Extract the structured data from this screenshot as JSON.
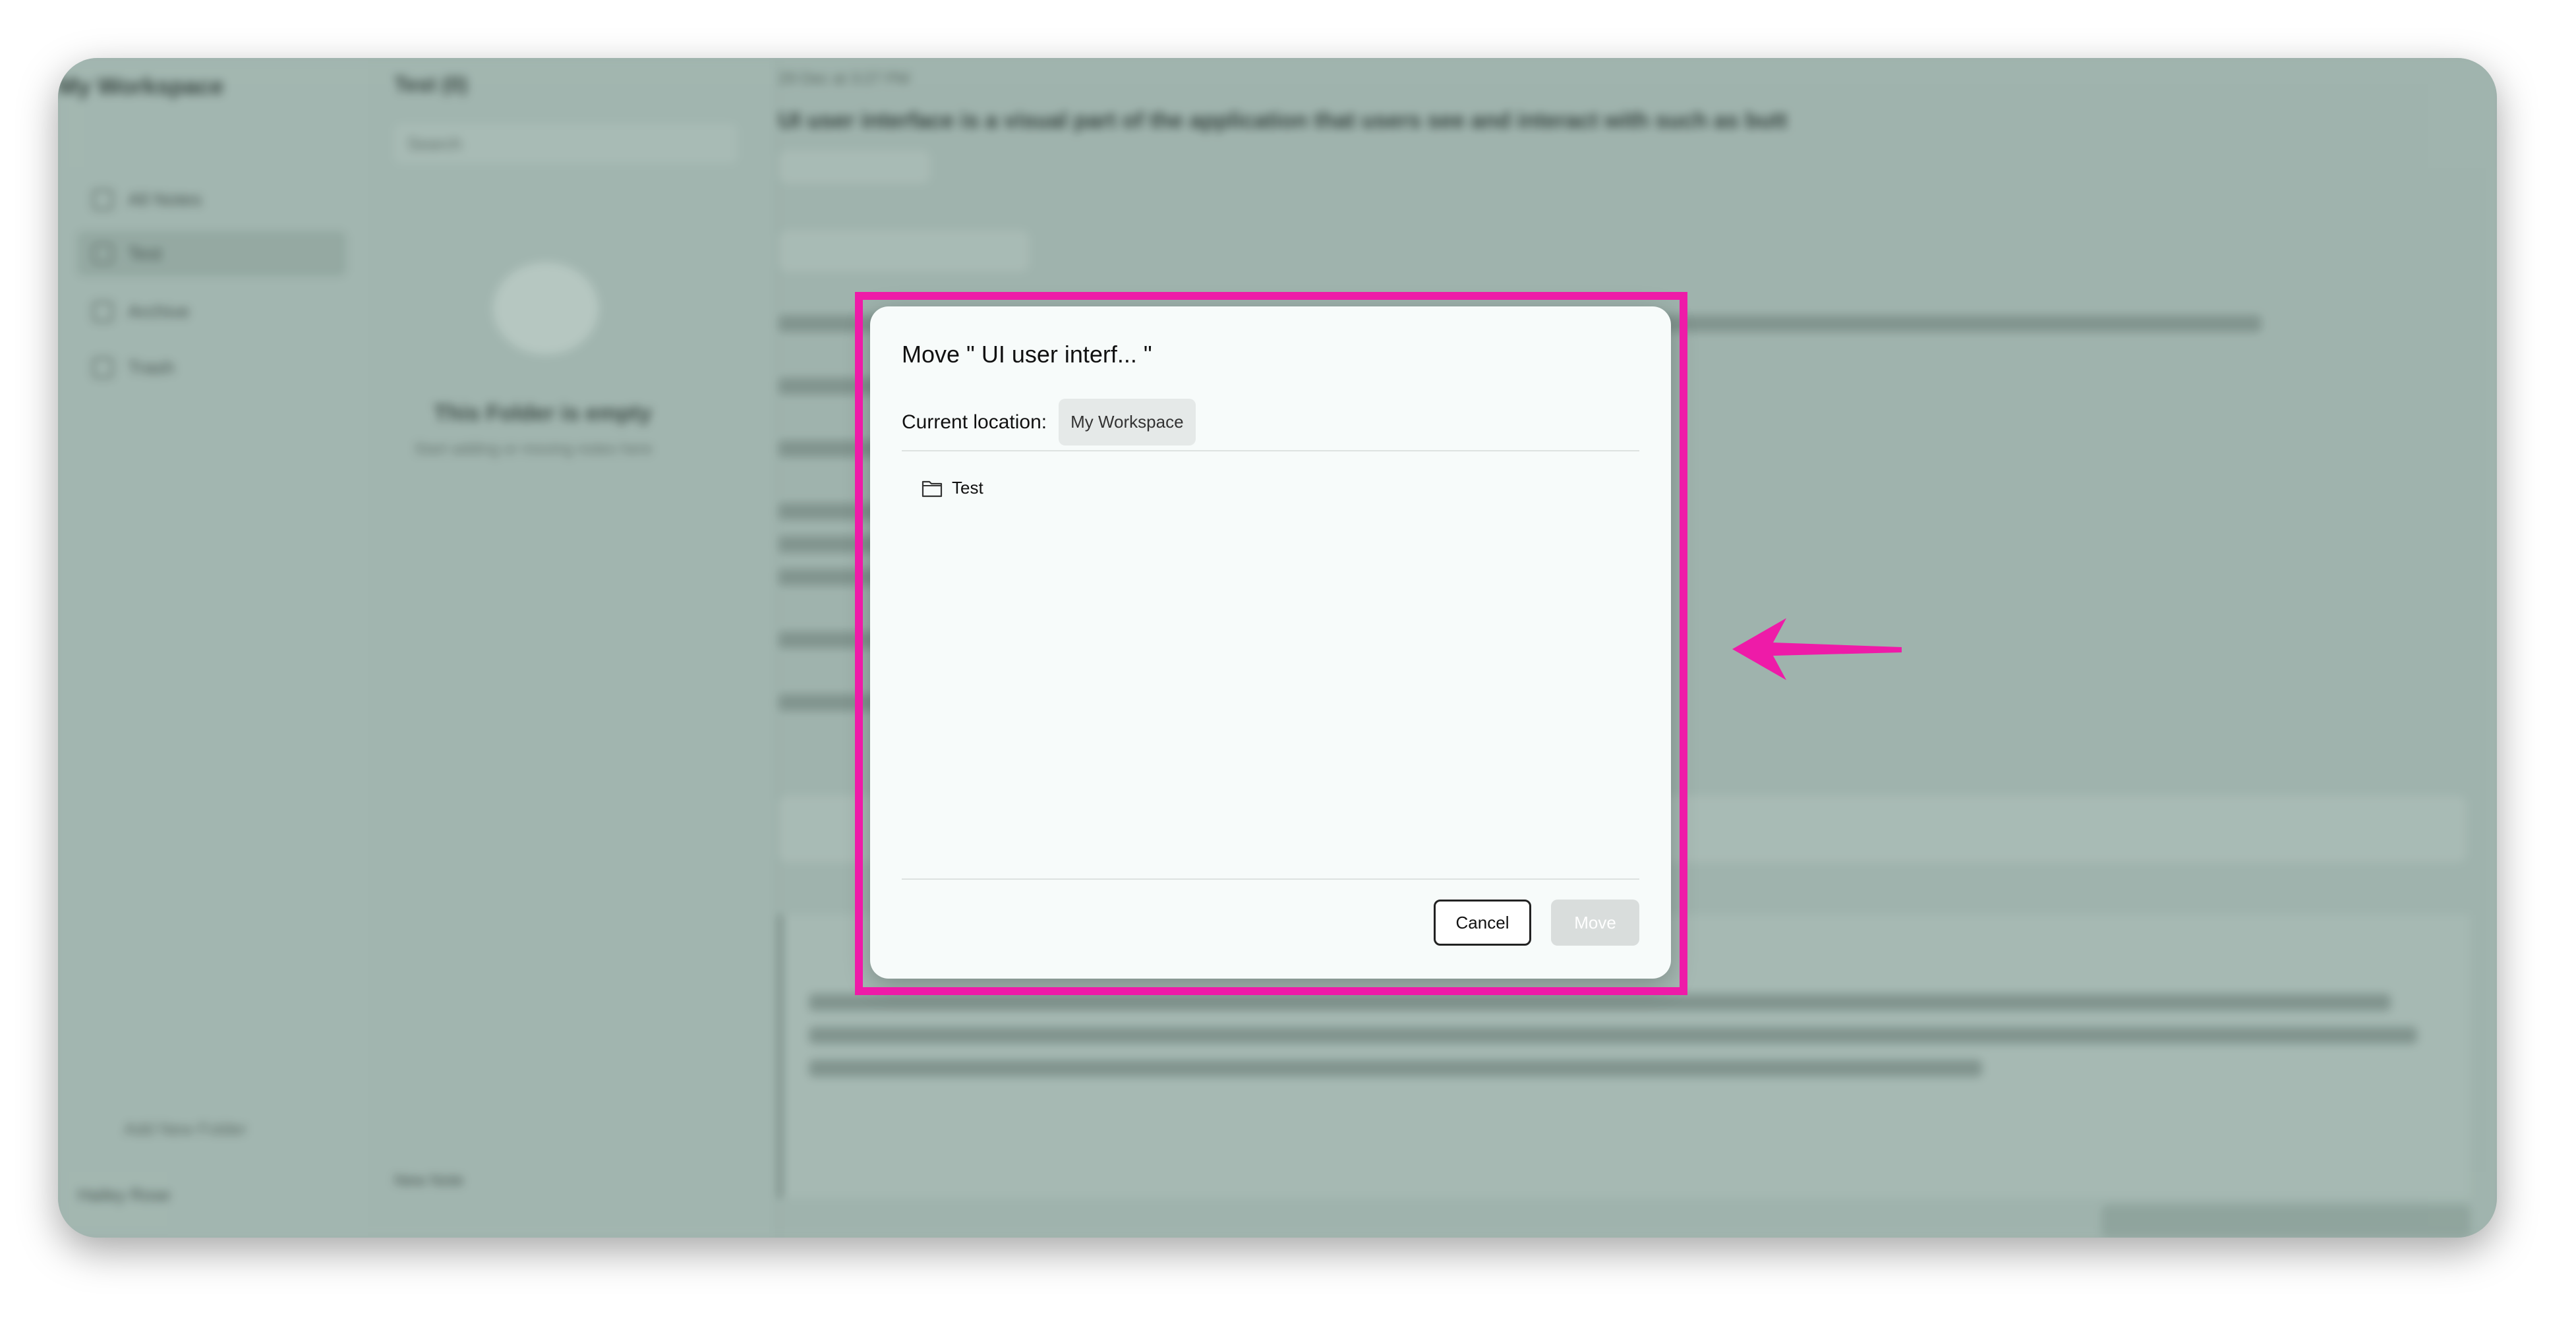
{
  "background_app": {
    "workspace_title": "My Workspace",
    "sidebar_items": [
      {
        "label": "All Notes",
        "active": false
      },
      {
        "label": "Test",
        "active": true
      },
      {
        "label": "Archive",
        "active": false
      },
      {
        "label": "Trash",
        "active": false
      }
    ],
    "add_folder_label": "Add New Folder",
    "user_name": "Hailey Rose",
    "notes_column_title": "Test (0)",
    "search_placeholder": "Search",
    "empty_title": "This Folder is empty",
    "empty_subtitle": "Start adding or moving notes here",
    "new_note_label": "New Note",
    "note_date": "29 Dec at 3:27 PM",
    "note_title": "UI user interface is a visual part of the application that users see and interact with such as butt"
  },
  "dialog": {
    "title": "Move \" UI user interf... \"",
    "current_location_label": "Current location:",
    "current_location_value": "My Workspace",
    "folders": [
      {
        "label": "Test",
        "icon": "folder-icon"
      }
    ],
    "cancel_label": "Cancel",
    "move_label": "Move",
    "move_enabled": false
  },
  "annotation": {
    "highlight_color": "#ee1ba8",
    "arrow_color": "#ee1ba8"
  }
}
